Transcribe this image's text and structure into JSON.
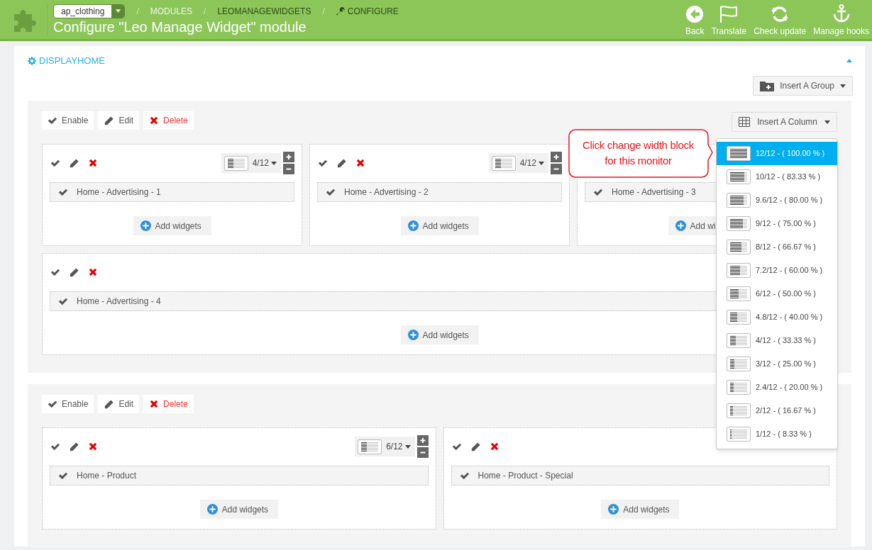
{
  "header": {
    "shop_select": "ap_clothing",
    "breadcrumbs": [
      {
        "separator": "/",
        "label": "MODULES",
        "kind": "plain"
      },
      {
        "separator": "/",
        "label": "LEOMANAGEWIDGETS",
        "kind": "plain"
      },
      {
        "separator": "/",
        "label": "CONFIGURE",
        "kind": "wrench"
      }
    ],
    "title": "Configure \"Leo Manage Widget\" module",
    "actions": [
      {
        "label": "Back",
        "kind": "back"
      },
      {
        "label": "Translate",
        "kind": "flag"
      },
      {
        "label": "Check update",
        "kind": "refresh"
      },
      {
        "label": "Manage hooks",
        "kind": "anchor"
      }
    ]
  },
  "section": {
    "title": "DISPLAYHOME",
    "expanded": true,
    "insert_group": "Insert A Group"
  },
  "groups": [
    {
      "actions": [
        {
          "label": "Enable",
          "kind": "enable"
        },
        {
          "label": "Edit",
          "kind": "edit"
        },
        {
          "label": "Delete",
          "kind": "delete"
        }
      ],
      "insert_column": "Insert A Column",
      "rows": [
        [
          {
            "tools": [
              {
                "kind": "enable"
              },
              {
                "kind": "edit"
              },
              {
                "kind": "delete"
              }
            ],
            "width": "4/12",
            "widgets": [
              "Home - Advertising - 1"
            ],
            "add": "Add widgets"
          },
          {
            "tools": [
              {
                "kind": "enable"
              },
              {
                "kind": "edit"
              },
              {
                "kind": "delete"
              }
            ],
            "width": "4/12",
            "widgets": [
              "Home - Advertising - 2"
            ],
            "add": "Add widgets"
          },
          {
            "widgets": [
              "Home - Advertising - 3"
            ],
            "add": "Add wi"
          }
        ],
        [
          {
            "tools": [
              {
                "kind": "enable"
              },
              {
                "kind": "edit"
              },
              {
                "kind": "delete"
              }
            ],
            "widgets": [
              "Home - Advertising - 4"
            ],
            "add": "Add widgets"
          }
        ]
      ]
    },
    {
      "actions": [
        {
          "label": "Enable",
          "kind": "enable"
        },
        {
          "label": "Edit",
          "kind": "edit"
        },
        {
          "label": "Delete",
          "kind": "delete"
        }
      ],
      "rows": [
        [
          {
            "tools": [
              {
                "kind": "enable"
              },
              {
                "kind": "edit"
              },
              {
                "kind": "delete"
              }
            ],
            "width": "6/12",
            "widgets": [
              "Home - Product"
            ],
            "add": "Add widgets"
          },
          {
            "tools": [
              {
                "kind": "enable"
              },
              {
                "kind": "edit"
              },
              {
                "kind": "delete"
              }
            ],
            "widgets": [
              "Home - Product - Special"
            ],
            "add": "Add widgets"
          }
        ]
      ]
    }
  ],
  "width_menu": [
    {
      "label": "12/12 - ( 100.00 % )",
      "selected": true,
      "level": 1
    },
    {
      "label": "10/12 - ( 83.33 % )",
      "selected": false,
      "level": 0.8333
    },
    {
      "label": "9.6/12 - ( 80.00 % )",
      "selected": false,
      "level": 0.8
    },
    {
      "label": "9/12 - ( 75.00 % )",
      "selected": false,
      "level": 0.75
    },
    {
      "label": "8/12 - ( 66.67 % )",
      "selected": false,
      "level": 0.6667
    },
    {
      "label": "7.2/12 - ( 60.00 % )",
      "selected": false,
      "level": 0.6
    },
    {
      "label": "6/12 - ( 50.00 % )",
      "selected": false,
      "level": 0.5
    },
    {
      "label": "4.8/12 - ( 40.00 % )",
      "selected": false,
      "level": 0.4
    },
    {
      "label": "4/12 - ( 33.33 % )",
      "selected": false,
      "level": 0.3333
    },
    {
      "label": "3/12 - ( 25.00 % )",
      "selected": false,
      "level": 0.25
    },
    {
      "label": "2.4/12 - ( 20.00 % )",
      "selected": false,
      "level": 0.2
    },
    {
      "label": "2/12 - ( 16.67 % )",
      "selected": false,
      "level": 0.1667
    },
    {
      "label": "1/12 - ( 8.33 % )",
      "selected": false,
      "level": 0.0833
    }
  ],
  "callout": {
    "lines": [
      "Click change width block",
      "for this monitor"
    ]
  }
}
